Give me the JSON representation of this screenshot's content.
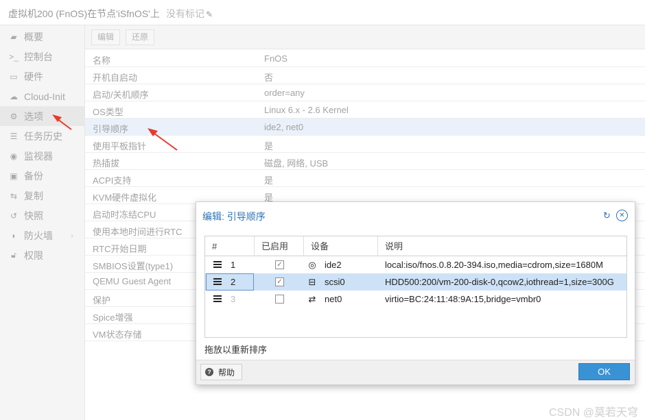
{
  "header": {
    "title": "虚拟机200 (FnOS)在节点'iSfnOS'上",
    "no_tag": "没有标记"
  },
  "sidebar": {
    "items": [
      {
        "label": "概要",
        "icon": "book-icon"
      },
      {
        "label": "控制台",
        "icon": "terminal-icon"
      },
      {
        "label": "硬件",
        "icon": "monitor-icon"
      },
      {
        "label": "Cloud-Init",
        "icon": "cloud-icon"
      },
      {
        "label": "选项",
        "icon": "gear-icon"
      },
      {
        "label": "任务历史",
        "icon": "list-icon"
      },
      {
        "label": "监视器",
        "icon": "eye-icon"
      },
      {
        "label": "备份",
        "icon": "floppy-icon"
      },
      {
        "label": "复制",
        "icon": "retweet-icon"
      },
      {
        "label": "快照",
        "icon": "history-icon"
      },
      {
        "label": "防火墙",
        "icon": "shield-icon"
      },
      {
        "label": "权限",
        "icon": "unlock-icon"
      }
    ]
  },
  "toolbar": {
    "edit": "编辑",
    "revert": "还原"
  },
  "options": [
    {
      "key": "名称",
      "value": "FnOS"
    },
    {
      "key": "开机自启动",
      "value": "否"
    },
    {
      "key": "启动/关机顺序",
      "value": "order=any"
    },
    {
      "key": "OS类型",
      "value": "Linux 6.x - 2.6 Kernel"
    },
    {
      "key": "引导顺序",
      "value": "ide2, net0"
    },
    {
      "key": "使用平板指针",
      "value": "是"
    },
    {
      "key": "热插拔",
      "value": "磁盘, 网络, USB"
    },
    {
      "key": "ACPI支持",
      "value": "是"
    },
    {
      "key": "KVM硬件虚拟化",
      "value": "是"
    },
    {
      "key": "启动时冻结CPU",
      "value": ""
    },
    {
      "key": "使用本地时间进行RTC",
      "value": ""
    },
    {
      "key": "RTC开始日期",
      "value": ""
    },
    {
      "key": "SMBIOS设置(type1)",
      "value": ""
    },
    {
      "key": "QEMU Guest Agent",
      "value": ""
    },
    {
      "key": "保护",
      "value": ""
    },
    {
      "key": "Spice增强",
      "value": ""
    },
    {
      "key": "VM状态存储",
      "value": ""
    }
  ],
  "dialog": {
    "title": "编辑: 引导顺序",
    "columns": {
      "num": "#",
      "enabled": "已启用",
      "device": "设备",
      "desc": "说明"
    },
    "rows": [
      {
        "num": "1",
        "enabled": true,
        "device": "ide2",
        "icon": "disc-icon",
        "desc": "local:iso/fnos.0.8.20-394.iso,media=cdrom,size=1680M"
      },
      {
        "num": "2",
        "enabled": true,
        "device": "scsi0",
        "icon": "hdd-icon",
        "desc": "HDD500:200/vm-200-disk-0,qcow2,iothread=1,size=300G"
      },
      {
        "num": "3",
        "enabled": false,
        "device": "net0",
        "icon": "exchange-icon",
        "desc": "virtio=BC:24:11:48:9A:15,bridge=vmbr0"
      }
    ],
    "drag_hint": "拖放以重新排序",
    "help": "帮助",
    "ok": "OK"
  },
  "watermark": "CSDN @莫若天穹",
  "colors": {
    "accent": "#3892d4",
    "title_blue": "#2f73b5",
    "selection": "#cde2f6",
    "arrow": "#e8392c"
  }
}
